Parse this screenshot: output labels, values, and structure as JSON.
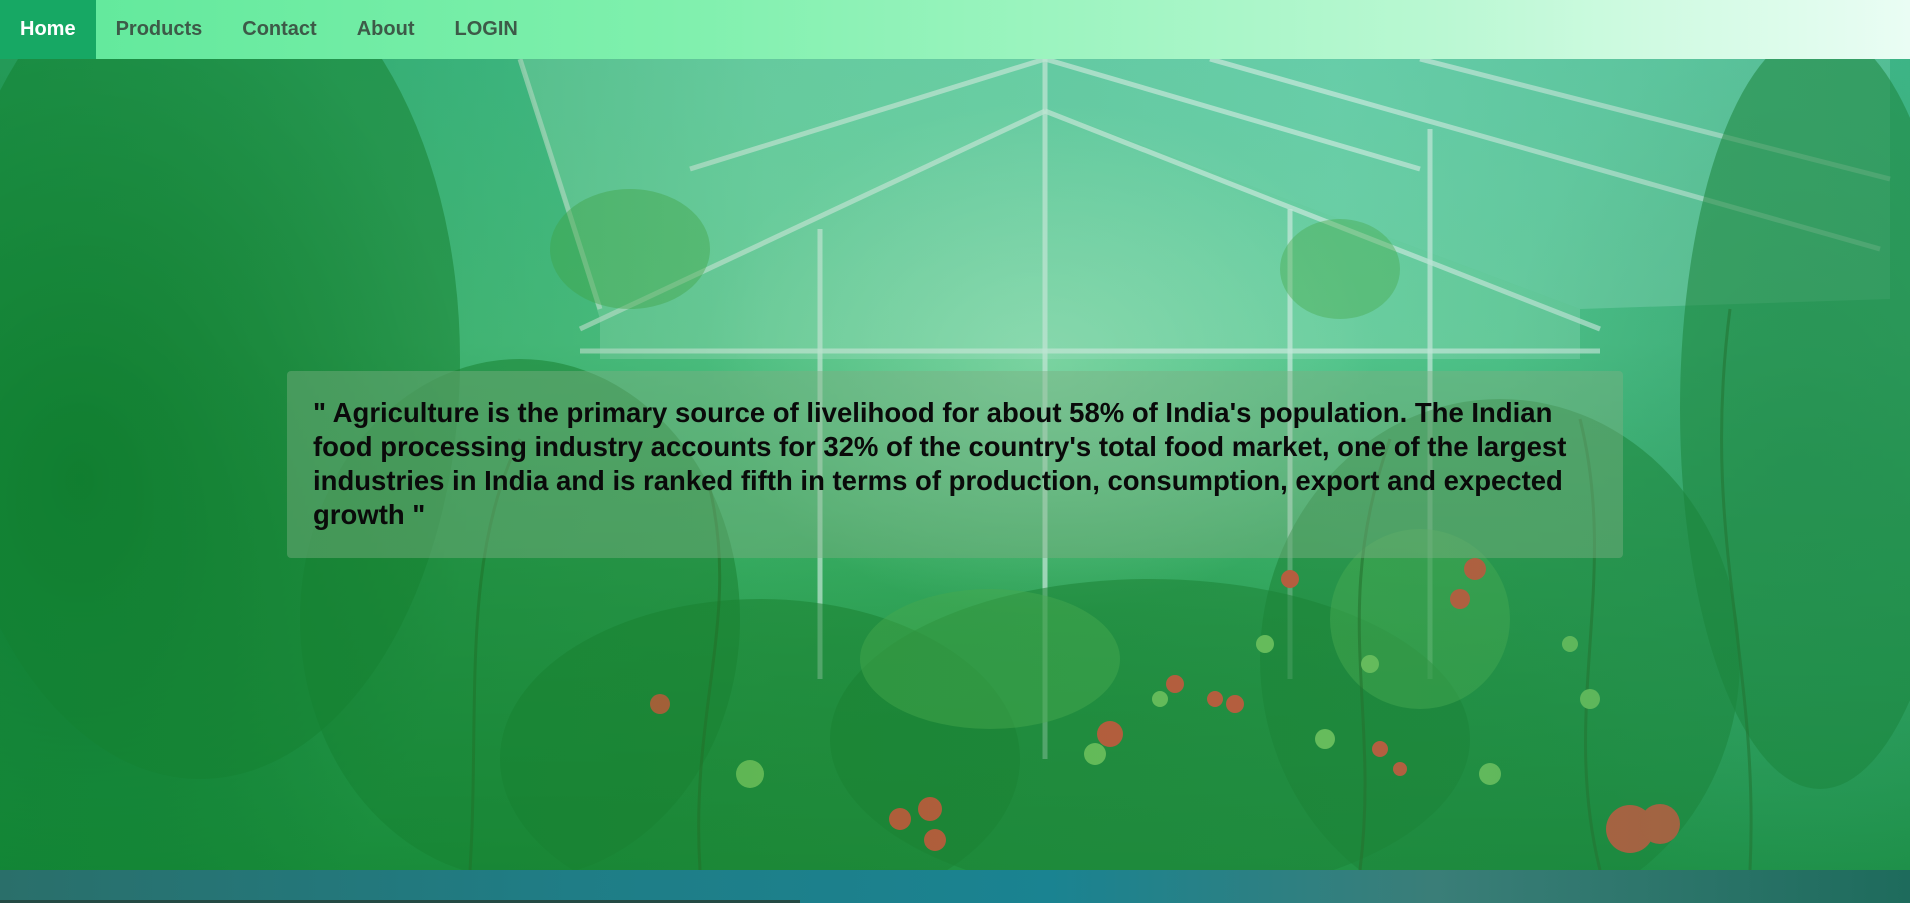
{
  "nav": {
    "items": [
      {
        "label": "Home",
        "active": true
      },
      {
        "label": "Products",
        "active": false
      },
      {
        "label": "Contact",
        "active": false
      },
      {
        "label": "About",
        "active": false
      },
      {
        "label": "LOGIN",
        "active": false
      }
    ]
  },
  "hero": {
    "quote": "\" Agriculture is the primary source of livelihood for about 58% of India's population. The Indian food processing industry accounts for 32% of the country's total food market, one of the largest industries in India and is ranked fifth in terms of production, consumption, export and expected growth \""
  },
  "colors": {
    "nav_active_bg": "#17a864",
    "nav_text": "#3d5a48",
    "nav_active_text": "#ffffff",
    "quote_text": "#0a0a0a"
  }
}
